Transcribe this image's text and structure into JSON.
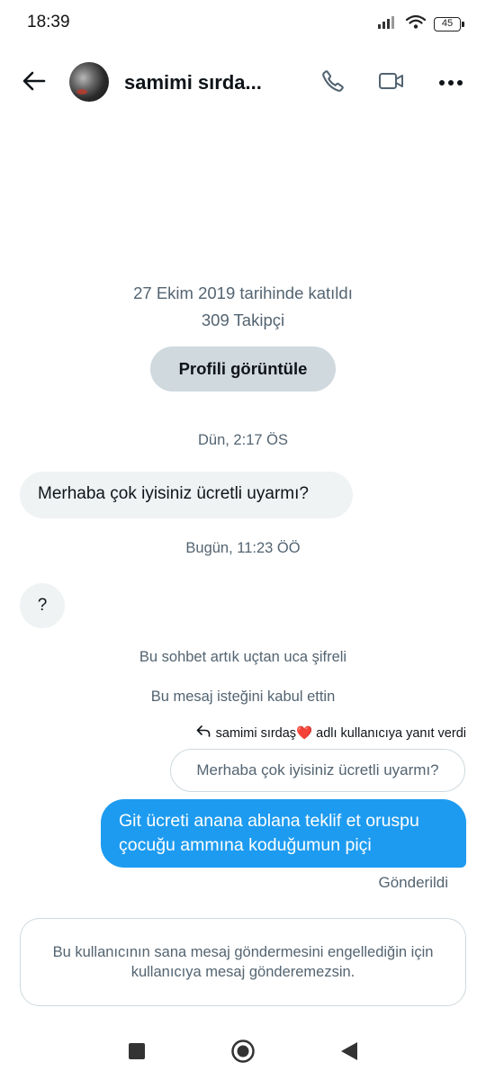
{
  "status_bar": {
    "time": "18:39",
    "battery": "45",
    "icons": [
      "signal-icon",
      "wifi-icon",
      "battery-icon"
    ]
  },
  "header": {
    "contact_name": "samimi sırda...",
    "icons": [
      "back-arrow-icon",
      "phone-icon",
      "video-camera-icon",
      "more-options-icon"
    ]
  },
  "profile": {
    "joined": "27 Ekim 2019 tarihinde katıldı",
    "followers": "309 Takipçi",
    "view_profile_label": "Profili görüntüle"
  },
  "conversation": [
    {
      "type": "timestamp",
      "text": "Dün, 2:17 ÖS"
    },
    {
      "type": "incoming",
      "text": "Merhaba çok iyisiniz ücretli uyarmı?"
    },
    {
      "type": "timestamp",
      "text": "Bugün, 11:23 ÖÖ"
    },
    {
      "type": "incoming",
      "text": "?"
    },
    {
      "type": "system",
      "text": "Bu sohbet artık uçtan uca şifreli"
    },
    {
      "type": "system",
      "text": "Bu mesaj isteğini kabul ettin"
    }
  ],
  "reply": {
    "label_prefix": "samimi sırdaş",
    "label_emoji": "❤️",
    "label_suffix": " adlı kullanıcıya yanıt verdi",
    "quoted_text": "Merhaba çok iyisiniz ücretli uyarmı?",
    "message": "Git ücreti anana ablana teklif et oruspu çocuğu ammına koduğumun piçi",
    "status": "Gönderildi"
  },
  "blocked_notice": "Bu kullanıcının sana mesaj göndermesini engellediğin için kullanıcıya mesaj gönderemezsin.",
  "nav_bar": {
    "icons": [
      "recent-apps-icon",
      "home-icon",
      "back-icon"
    ]
  },
  "colors": {
    "accent": "#1d9bf0",
    "secondary_text": "#536471",
    "bubble_in": "#eff3f4",
    "button_bg": "#cfd9de"
  }
}
